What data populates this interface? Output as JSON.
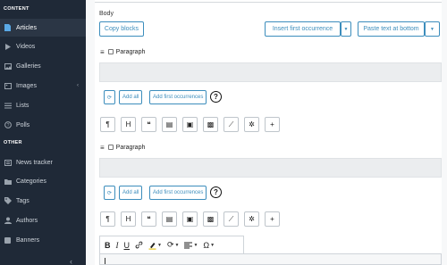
{
  "sidebar": {
    "section_content": "CONTENT",
    "section_other": "OTHER",
    "items": [
      {
        "label": "Articles",
        "icon": "document-icon"
      },
      {
        "label": "Videos",
        "icon": "play-icon"
      },
      {
        "label": "Galleries",
        "icon": "image-icon"
      },
      {
        "label": "Images",
        "icon": "images-icon"
      },
      {
        "label": "Lists",
        "icon": "list-icon"
      },
      {
        "label": "Polls",
        "icon": "help-circle-icon"
      },
      {
        "label": "News tracker",
        "icon": "news-icon"
      },
      {
        "label": "Categories",
        "icon": "folder-icon"
      },
      {
        "label": "Tags",
        "icon": "tag-icon"
      },
      {
        "label": "Authors",
        "icon": "user-icon"
      },
      {
        "label": "Banners",
        "icon": "banner-icon"
      }
    ],
    "active_item": "Articles"
  },
  "form": {
    "body_label": "Body",
    "copy_blocks": "Copy blocks",
    "insert_first_occurrence": "Insert first occurrence",
    "paste_text_at_bottom": "Paste text at bottom"
  },
  "blocks": [
    {
      "type_label": "Paragraph",
      "add_all": "Add all",
      "add_first": "Add first occurrences"
    },
    {
      "type_label": "Paragraph",
      "add_all": "Add all",
      "add_first": "Add first occurrences"
    }
  ],
  "block_tools": [
    "paragraph-icon",
    "heading-icon",
    "quote-icon",
    "document-icon",
    "image-icon",
    "gallery-icon",
    "chart-icon",
    "embed-icon",
    "plus-icon"
  ],
  "block_tool_glyphs": [
    "¶",
    "H",
    "❝",
    "▤",
    "▣",
    "▩",
    "⟋",
    "✲",
    "+"
  ],
  "editor_toolbar": {
    "bold": "B",
    "italic": "I",
    "underline": "U",
    "link": "🔗",
    "highlight": "✎",
    "special": "Ω"
  },
  "colors": {
    "sidebar_bg": "#1f2937",
    "accent": "#3c8dbc",
    "active_icon": "#5aa9e6"
  }
}
